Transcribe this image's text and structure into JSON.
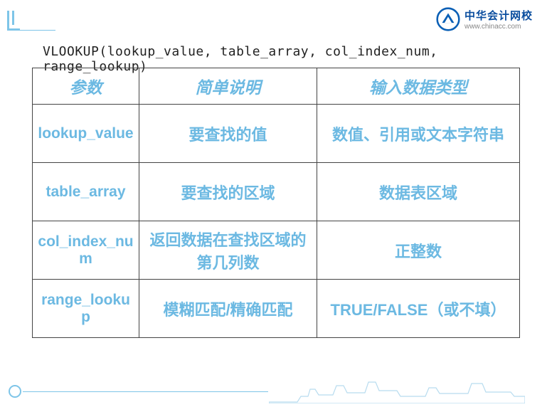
{
  "logo": {
    "title_cn": "中华会计网校",
    "url": "www.chinacc.com"
  },
  "formula": "VLOOKUP(lookup_value,   table_array,    col_index_num,   range_lookup)",
  "table": {
    "headers": [
      "参数",
      "简单说明",
      "输入数据类型"
    ],
    "rows": [
      {
        "param": "lookup_value",
        "desc": "要查找的值",
        "type": "数值、引用或文本字符串"
      },
      {
        "param": "table_array",
        "desc": "要查找的区域",
        "type": "数据表区域"
      },
      {
        "param": "col_index_num",
        "desc": "返回数据在查找区域的第几列数",
        "type": "正整数"
      },
      {
        "param": "range_lookup",
        "desc": "模糊匹配/精确匹配",
        "type": "TRUE/FALSE（或不填）"
      }
    ]
  }
}
